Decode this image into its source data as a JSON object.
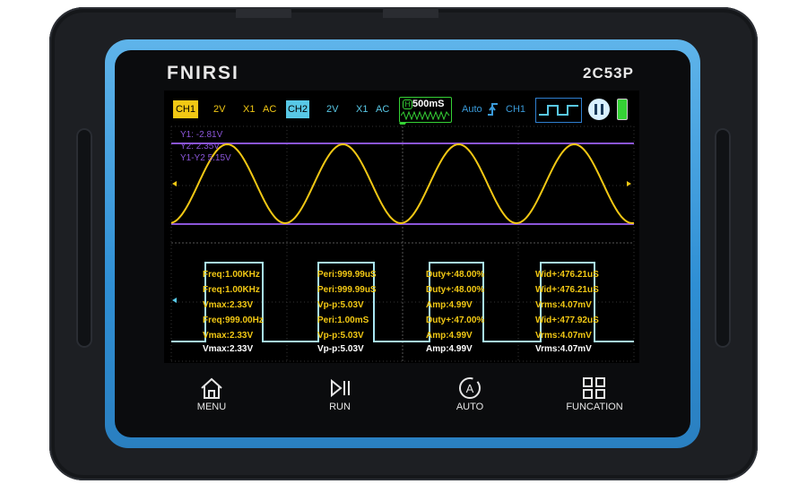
{
  "device": {
    "brand": "FNIRSI",
    "model": "2C53P"
  },
  "topbar": {
    "ch1": {
      "label": "CH1",
      "volts": "2V",
      "probe": "X1",
      "coupling": "AC"
    },
    "ch2": {
      "label": "CH2",
      "volts": "2V",
      "probe": "X1",
      "coupling": "AC"
    },
    "timebase": "500mS",
    "trigger_mode": "Auto",
    "trigger_source": "CH1"
  },
  "cursors": {
    "y1": "Y1:   -2.81V",
    "y2": "Y2:   2.35V",
    "diff": "Y1-Y2   5.15V"
  },
  "measurements": [
    {
      "text": "Freq:1.00KHz",
      "col": 0,
      "row": 0
    },
    {
      "text": "Peri:999.99uS",
      "col": 1,
      "row": 0
    },
    {
      "text": "Duty+:48.00%",
      "col": 2,
      "row": 0
    },
    {
      "text": "Wid+:476.21uS",
      "col": 3,
      "row": 0
    },
    {
      "text": "Freq:1.00KHz",
      "col": 0,
      "row": 1
    },
    {
      "text": "Peri:999.99uS",
      "col": 1,
      "row": 1
    },
    {
      "text": "Duty+:48.00%",
      "col": 2,
      "row": 1
    },
    {
      "text": "Wid+:476.21uS",
      "col": 3,
      "row": 1
    },
    {
      "text": "Vmax:2.33V",
      "col": 0,
      "row": 2
    },
    {
      "text": "Vp-p:5.03V",
      "col": 1,
      "row": 2
    },
    {
      "text": "Amp:4.99V",
      "col": 2,
      "row": 2
    },
    {
      "text": "Vrms:4.07mV",
      "col": 3,
      "row": 2
    },
    {
      "text": "Freq:999.00Hz",
      "col": 0,
      "row": 3
    },
    {
      "text": "Peri:1.00mS",
      "col": 1,
      "row": 3
    },
    {
      "text": "Duty+:47.00%",
      "col": 2,
      "row": 3
    },
    {
      "text": "Wid+:477.92uS",
      "col": 3,
      "row": 3
    },
    {
      "text": "Vmax:2.33V",
      "col": 0,
      "row": 4
    },
    {
      "text": "Vp-p:5.03V",
      "col": 1,
      "row": 4
    },
    {
      "text": "Amp:4.99V",
      "col": 2,
      "row": 4
    },
    {
      "text": "Vrms:4.07mV",
      "col": 3,
      "row": 4
    },
    {
      "text": "Vmax:2.33V",
      "col": 0,
      "row": 5
    },
    {
      "text": "Vp-p:5.03V",
      "col": 1,
      "row": 5
    },
    {
      "text": "Amp:4.99V",
      "col": 2,
      "row": 5
    },
    {
      "text": "Vrms:4.07mV",
      "col": 3,
      "row": 5
    }
  ],
  "buttons": {
    "menu": "MENU",
    "run": "RUN",
    "auto": "AUTO",
    "function": "FUNCATION"
  },
  "colors": {
    "ch1": "#f2c814",
    "ch2": "#58c8e6",
    "cursor": "#8a55d8",
    "bezel": "#3a9ee0"
  }
}
